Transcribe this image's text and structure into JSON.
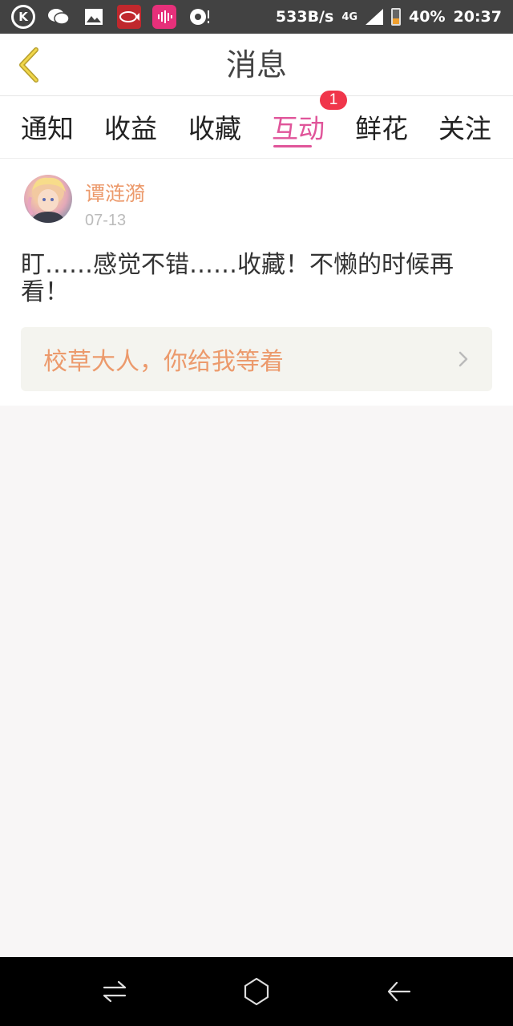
{
  "status_bar": {
    "network_speed": "533B/s",
    "network_type": "4G",
    "battery": "40%",
    "time": "20:37",
    "icons": [
      "k-app-icon",
      "wechat-icon",
      "gallery-icon",
      "fish-app-icon",
      "voice-app-icon",
      "tencent-video-icon"
    ]
  },
  "header": {
    "title": "消息"
  },
  "tabs": [
    {
      "label": "通知"
    },
    {
      "label": "收益"
    },
    {
      "label": "收藏"
    },
    {
      "label": "互动",
      "active": true,
      "badge": "1"
    },
    {
      "label": "鲜花"
    },
    {
      "label": "关注"
    }
  ],
  "message": {
    "username": "谭涟漪",
    "date": "07-13",
    "comment": "盯……感觉不错……收藏！不懒的时候再看！",
    "linked_title": "校草大人，你给我等着"
  },
  "colors": {
    "accent_pink": "#e0559a",
    "accent_orange": "#ec9a6c",
    "badge_red": "#f0364b"
  }
}
